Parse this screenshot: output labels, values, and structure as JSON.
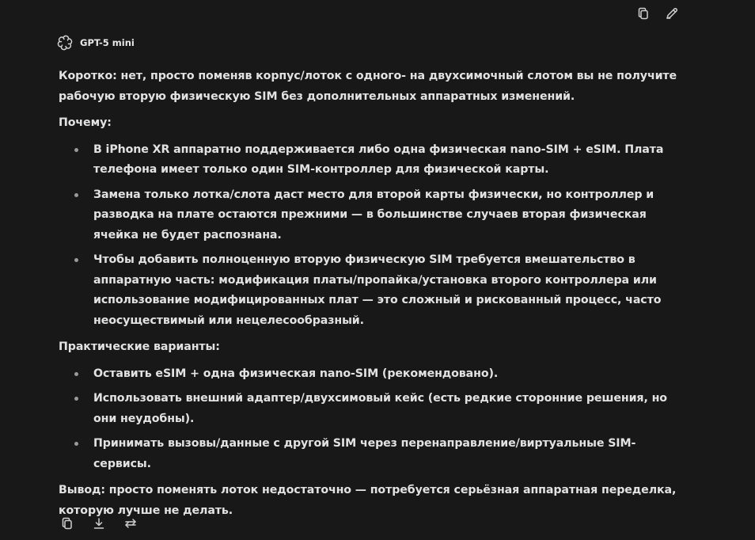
{
  "toolbar": {
    "icons": [
      "copy-icon",
      "edit-icon"
    ]
  },
  "model": {
    "name": "GPT-5 mini",
    "icon": "openai-logo-icon"
  },
  "message": {
    "intro": "Коротко: нет, просто поменяв корпус/лоток с одного- на двухсимочный слотом вы не получите рабочую вторую физическую SIM без дополнительных аппаратных изменений.",
    "why_heading": "Почему:",
    "why_items": [
      "В iPhone XR аппаратно поддерживается либо одна физическая nano-SIM + eSIM. Плата телефона имеет только один SIM-контроллер для физической карты.",
      "Замена только лотка/слота даст место для второй карты физически, но контроллер и разводка на плате остаются прежними — в большинстве случаев вторая физическая ячейка не будет распознана.",
      "Чтобы добавить полноценную вторую физическую SIM требуется вмешательство в аппаратную часть: модификация платы/пропайка/установка второго контроллера или использование модифицированных плат — это сложный и рискованный процесс, часто неосуществимый или нецелесообразный."
    ],
    "options_heading": "Практические варианты:",
    "options_items": [
      "Оставить eSIM + одна физическая nano-SIM (рекомендовано).",
      "Использовать внешний адаптер/двухсимовый кейс (есть редкие сторонние решения, но они неудобны).",
      "Принимать вызовы/данные с другой SIM через перенаправление/виртуальные SIM-сервисы."
    ],
    "conclusion": "Вывод: просто поменять лоток недостаточно — потребуется серьёзная аппаратная переделка, которую лучше не делать."
  },
  "actions": {
    "icons": [
      "copy-icon",
      "download-icon",
      "regenerate-icon"
    ]
  },
  "colors": {
    "background": "#181818",
    "text": "#e2e2e2",
    "icon": "#cfcfcf",
    "bullet": "#9a9a9a"
  }
}
